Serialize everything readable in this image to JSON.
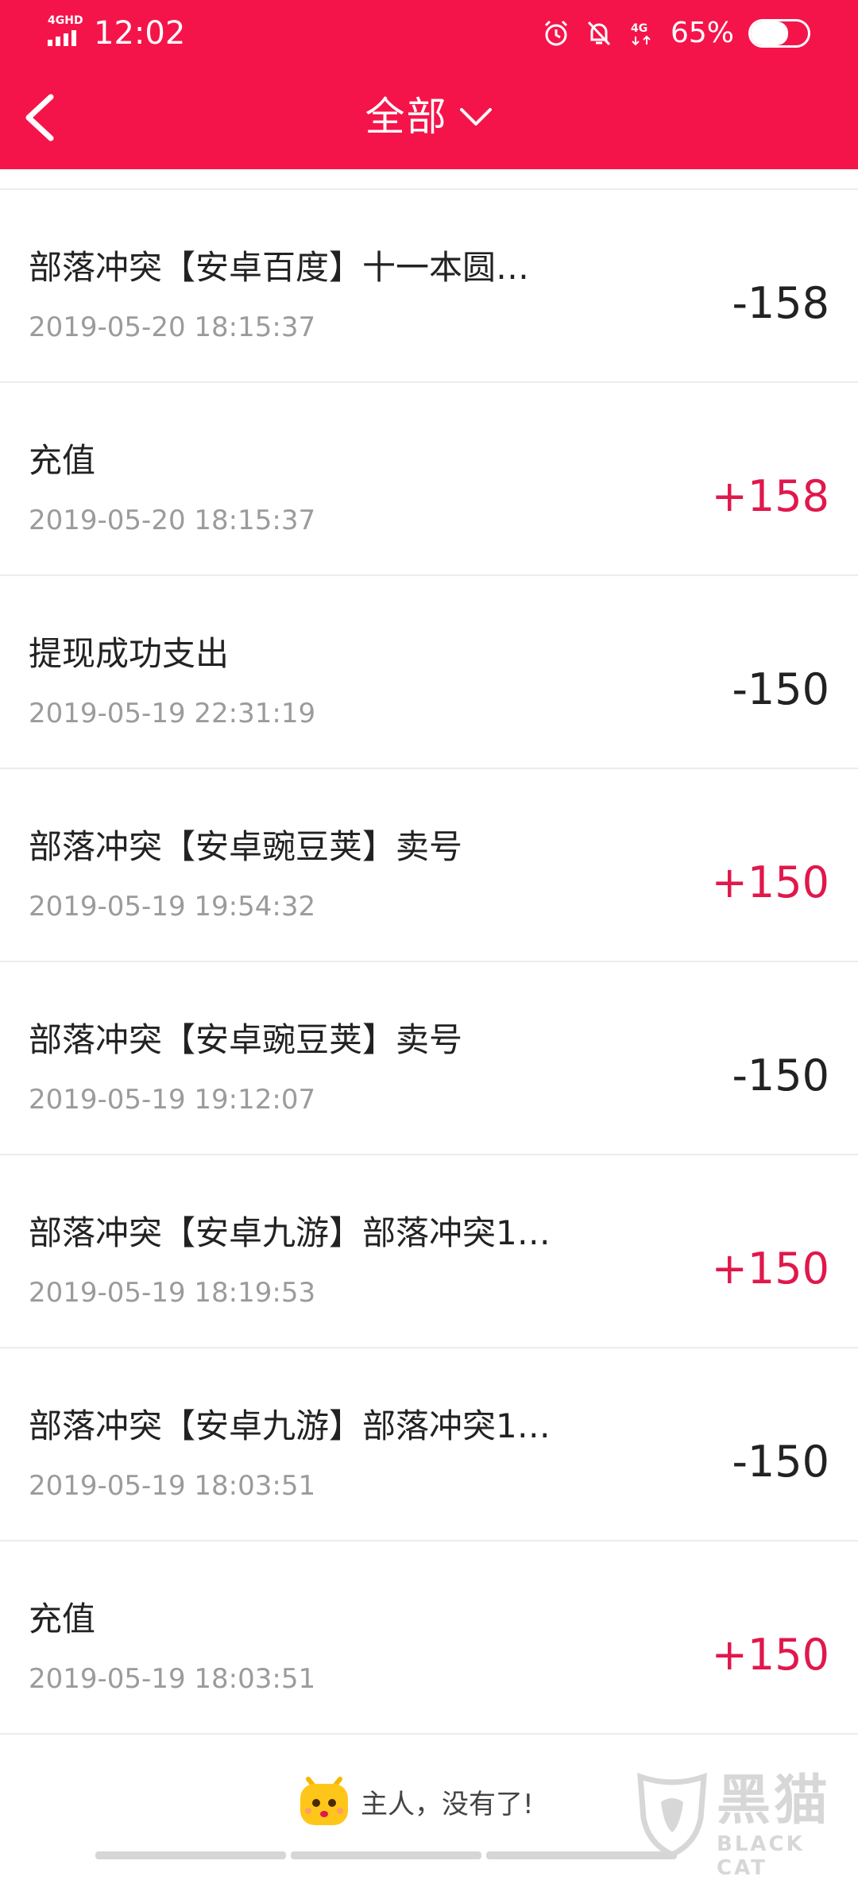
{
  "status_bar": {
    "network_label": "4GHD",
    "time": "12:02",
    "battery_percent": "65%",
    "battery_level": 0.65
  },
  "header": {
    "title": "全部"
  },
  "colors": {
    "accent": "#f5144a",
    "income": "#e0184c",
    "expense": "#222222"
  },
  "transactions": [
    {
      "name": "部落冲突【安卓百度】十一本圆…",
      "date": "2019-05-20 18:15:37",
      "amount": "-158"
    },
    {
      "name": "充值",
      "date": "2019-05-20 18:15:37",
      "amount": "+158"
    },
    {
      "name": "提现成功支出",
      "date": "2019-05-19 22:31:19",
      "amount": "-150"
    },
    {
      "name": "部落冲突【安卓豌豆荚】卖号",
      "date": "2019-05-19 19:54:32",
      "amount": "+150"
    },
    {
      "name": "部落冲突【安卓豌豆荚】卖号",
      "date": "2019-05-19 19:12:07",
      "amount": "-150"
    },
    {
      "name": "部落冲突【安卓九游】部落冲突1…",
      "date": "2019-05-19 18:19:53",
      "amount": "+150"
    },
    {
      "name": "部落冲突【安卓九游】部落冲突1…",
      "date": "2019-05-19 18:03:51",
      "amount": "-150"
    },
    {
      "name": "充值",
      "date": "2019-05-19 18:03:51",
      "amount": "+150"
    }
  ],
  "footer": {
    "end_message": "主人，没有了!"
  },
  "watermark": {
    "brand": "黑猫",
    "brand_en": "BLACK CAT"
  }
}
